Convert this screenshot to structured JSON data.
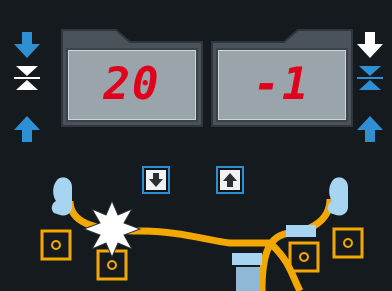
{
  "displays": {
    "left": {
      "value": "20"
    },
    "right": {
      "value": "-1"
    }
  },
  "colors": {
    "background": "#151a1e",
    "lcd_digits": "#e0001b",
    "accent_blue": "#2f8fd3",
    "pipe_orange": "#f2a800",
    "light_blue": "#a6d4f1"
  },
  "icons": {
    "left_down": "arrow-down-icon",
    "left_compress": "compress-icon",
    "left_up": "arrow-up-icon",
    "right_down": "arrow-down-icon",
    "right_compress": "compress-icon",
    "right_up": "arrow-up-icon",
    "decrease": "arrow-down-icon",
    "increase": "arrow-up-icon",
    "spark": "spark-icon"
  }
}
